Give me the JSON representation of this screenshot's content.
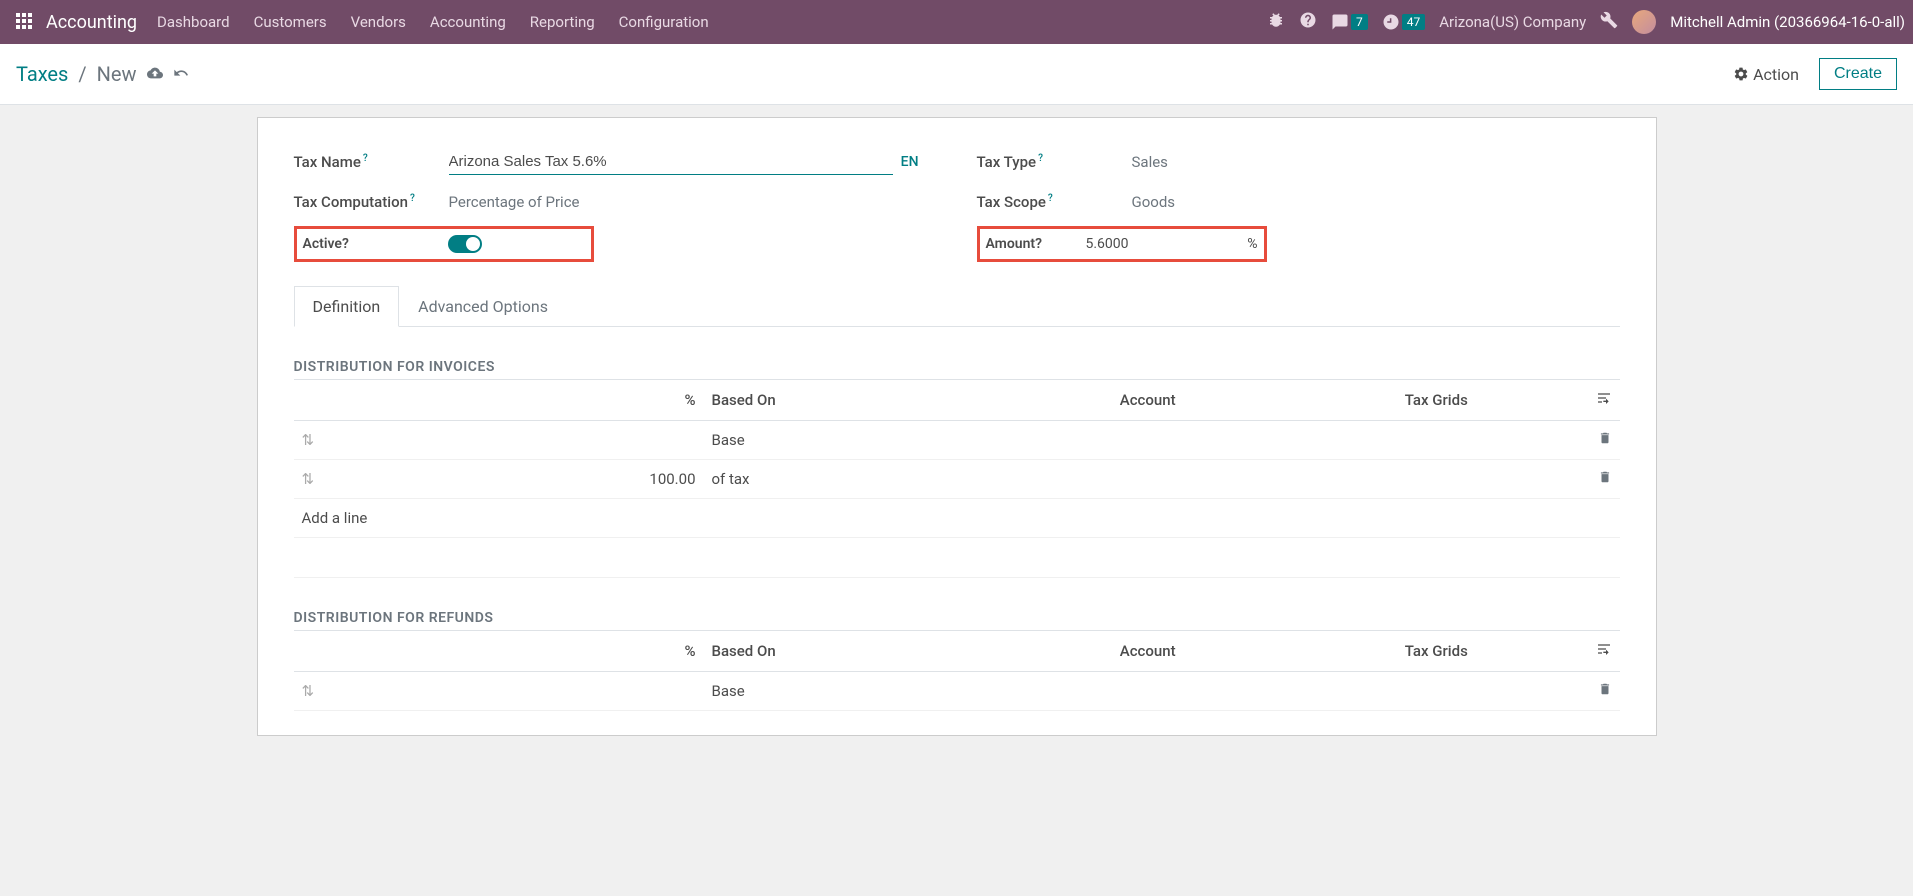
{
  "topbar": {
    "brand": "Accounting",
    "menu": [
      "Dashboard",
      "Customers",
      "Vendors",
      "Accounting",
      "Reporting",
      "Configuration"
    ],
    "messages_badge": "7",
    "activities_badge": "47",
    "company": "Arizona(US) Company",
    "user": "Mitchell Admin (20366964-16-0-all)"
  },
  "breadcrumb": {
    "root": "Taxes",
    "current": "New"
  },
  "buttons": {
    "action": "Action",
    "create": "Create"
  },
  "form": {
    "tax_name_label": "Tax Name",
    "tax_name_value": "Arizona Sales Tax 5.6%",
    "lang_badge": "EN",
    "tax_computation_label": "Tax Computation",
    "tax_computation_value": "Percentage of Price",
    "active_label": "Active",
    "tax_type_label": "Tax Type",
    "tax_type_value": "Sales",
    "tax_scope_label": "Tax Scope",
    "tax_scope_value": "Goods",
    "amount_label": "Amount",
    "amount_value": "5.6000",
    "amount_unit": "%"
  },
  "tabs": {
    "definition": "Definition",
    "advanced": "Advanced Options"
  },
  "sections": {
    "invoices_title": "DISTRIBUTION FOR INVOICES",
    "refunds_title": "DISTRIBUTION FOR REFUNDS"
  },
  "dist_headers": {
    "percent": "%",
    "based_on": "Based On",
    "account": "Account",
    "tax_grids": "Tax Grids"
  },
  "dist_invoices": [
    {
      "percent": "",
      "based_on": "Base"
    },
    {
      "percent": "100.00",
      "based_on": "of tax"
    }
  ],
  "dist_refunds": [
    {
      "percent": "",
      "based_on": "Base"
    }
  ],
  "add_line": "Add a line"
}
